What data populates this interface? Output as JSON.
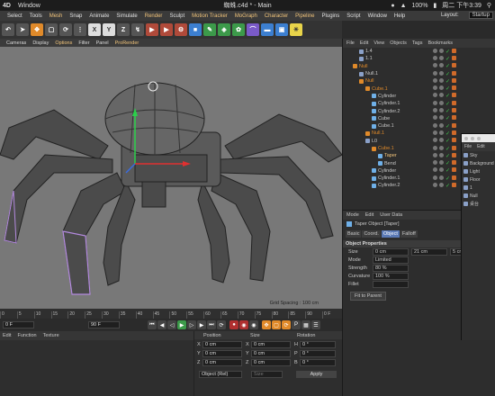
{
  "mac": {
    "app": "4D",
    "window_menu": "Window",
    "title": "蜘蛛.c4d * - Main",
    "battery": "100%",
    "clock": "周二 下午3:39"
  },
  "menu": {
    "items": [
      "Select",
      "Tools",
      "Mesh",
      "Snap",
      "Animate",
      "Simulate",
      "Render",
      "Sculpt",
      "Motion Tracker",
      "MoGraph",
      "Character",
      "Pipeline",
      "Plugins",
      "Script",
      "Window",
      "Help"
    ],
    "highlight": [
      "Mesh",
      "Render",
      "Motion Tracker",
      "MoGraph",
      "Character",
      "Pipeline"
    ],
    "layout_label": "Layout:",
    "layout_value": "Startup"
  },
  "toolbar": {
    "axis_buttons": [
      "X",
      "Y",
      "Z"
    ]
  },
  "viewport_menu": {
    "items": [
      "Cameras",
      "Display",
      "Options",
      "Filter",
      "Panel",
      "ProRender"
    ],
    "highlight": [
      "Options",
      "ProRender"
    ]
  },
  "viewport": {
    "grid_spacing": "Grid Spacing : 100 cm"
  },
  "timeline": {
    "ticks": [
      "0",
      "5",
      "10",
      "15",
      "20",
      "25",
      "30",
      "35",
      "40",
      "45",
      "50",
      "55",
      "60",
      "65",
      "70",
      "75",
      "80",
      "85",
      "90"
    ],
    "end_frame": "0 F"
  },
  "transport": {
    "start_field": "0 F",
    "end_field": "90 F"
  },
  "material": {
    "menu": [
      "Edit",
      "Function",
      "Texture"
    ]
  },
  "coords": {
    "headers": [
      "Position",
      "Size",
      "Rotation"
    ],
    "rows": [
      {
        "axis": "X",
        "pos": "0 cm",
        "size_axis": "X",
        "size": "0 cm",
        "rot_axis": "H",
        "rot": "0 °"
      },
      {
        "axis": "Y",
        "pos": "0 cm",
        "size_axis": "Y",
        "size": "0 cm",
        "rot_axis": "P",
        "rot": "0 °"
      },
      {
        "axis": "Z",
        "pos": "0 cm",
        "size_axis": "Z",
        "size": "0 cm",
        "rot_axis": "B",
        "rot": "0 °"
      }
    ],
    "mode_select": "Object (Rel)",
    "size_select": "Size",
    "apply": "Apply"
  },
  "object_manager": {
    "menu": [
      "File",
      "Edit",
      "View",
      "Objects",
      "Tags",
      "Bookmarks"
    ],
    "rows": [
      {
        "name": "1.4",
        "indent": 2,
        "color": "#8aa0c8",
        "label_color": "#c8c8c8"
      },
      {
        "name": "1.1",
        "indent": 2,
        "color": "#8aa0c8",
        "label_color": "#c8c8c8"
      },
      {
        "name": "Null",
        "indent": 1,
        "color": "#e08a2a",
        "label_color": "#e08a2a"
      },
      {
        "name": "Null.1",
        "indent": 2,
        "color": "#8aa0c8",
        "label_color": "#c8c8c8"
      },
      {
        "name": "Null",
        "indent": 2,
        "color": "#e08a2a",
        "label_color": "#e08a2a"
      },
      {
        "name": "Cube.1",
        "indent": 3,
        "color": "#e08a2a",
        "label_color": "#e08a2a"
      },
      {
        "name": "Cylinder",
        "indent": 4,
        "color": "#6fb0e8",
        "label_color": "#c8c8c8"
      },
      {
        "name": "Cylinder.1",
        "indent": 4,
        "color": "#6fb0e8",
        "label_color": "#c8c8c8"
      },
      {
        "name": "Cylinder.2",
        "indent": 4,
        "color": "#6fb0e8",
        "label_color": "#c8c8c8"
      },
      {
        "name": "Cube",
        "indent": 4,
        "color": "#6fb0e8",
        "label_color": "#c8c8c8"
      },
      {
        "name": "Cube.1",
        "indent": 4,
        "color": "#6fb0e8",
        "label_color": "#c8c8c8"
      },
      {
        "name": "Null.1",
        "indent": 3,
        "color": "#e08a2a",
        "label_color": "#e08a2a"
      },
      {
        "name": "L0",
        "indent": 3,
        "color": "#8aa0c8",
        "label_color": "#c8c8c8"
      },
      {
        "name": "Cube.1",
        "indent": 4,
        "color": "#e08a2a",
        "label_color": "#e08a2a"
      },
      {
        "name": "Taper",
        "indent": 5,
        "color": "#6fb0e8",
        "label_color": "#f0c37a"
      },
      {
        "name": "Bend",
        "indent": 5,
        "color": "#6fb0e8",
        "label_color": "#c8c8c8"
      },
      {
        "name": "Cylinder",
        "indent": 4,
        "color": "#6fb0e8",
        "label_color": "#c8c8c8"
      },
      {
        "name": "Cylinder.1",
        "indent": 4,
        "color": "#6fb0e8",
        "label_color": "#c8c8c8"
      },
      {
        "name": "Cylinder.2",
        "indent": 4,
        "color": "#6fb0e8",
        "label_color": "#c8c8c8"
      }
    ]
  },
  "attributes": {
    "menu": [
      "Mode",
      "Edit",
      "User Data"
    ],
    "object_title": "Taper Object [Taper]",
    "tabs": [
      "Basic",
      "Coord.",
      "Object",
      "Falloff"
    ],
    "active_tab": "Object",
    "section": "Object Properties",
    "props": [
      {
        "label": "Size",
        "v1": "0 cm",
        "v2": "21 cm",
        "v3": "5 cm"
      },
      {
        "label": "Mode",
        "v1": "Limited",
        "v2": "",
        "v3": ""
      },
      {
        "label": "Strength",
        "v1": "80 %",
        "v2": "",
        "v3": ""
      },
      {
        "label": "Curvature",
        "v1": "100 %",
        "v2": "",
        "v3": ""
      },
      {
        "label": "Fillet",
        "v1": "",
        "v2": "",
        "v3": ""
      }
    ],
    "fit_button": "Fit to Parent"
  },
  "float_window": {
    "menu": [
      "File",
      "Edit"
    ],
    "rows": [
      "Sky",
      "Background",
      "Light",
      "Floor",
      "1",
      "Null",
      "桌台"
    ]
  }
}
